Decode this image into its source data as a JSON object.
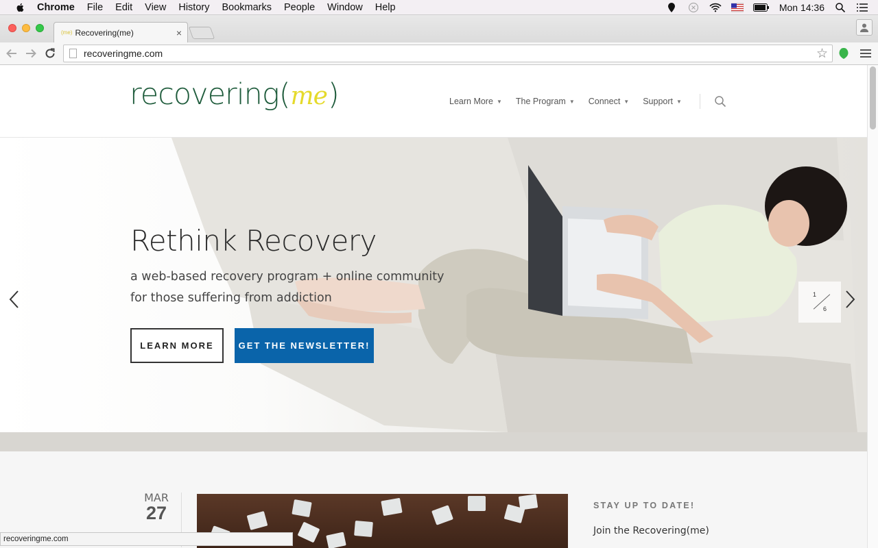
{
  "menubar": {
    "app": "Chrome",
    "items": [
      "File",
      "Edit",
      "View",
      "History",
      "Bookmarks",
      "People",
      "Window",
      "Help"
    ],
    "clock": "Mon 14:36"
  },
  "browser": {
    "tab_title": "Recovering(me)",
    "tab_favicon": "(me)",
    "url": "recoveringme.com",
    "status_url": "recoveringme.com"
  },
  "site": {
    "logo_prefix": "recovering(",
    "logo_me": "me",
    "logo_suffix": ")",
    "nav": [
      "Learn More",
      "The Program",
      "Connect",
      "Support"
    ],
    "hero": {
      "title": "Rethink Recovery",
      "subtitle_line1": "a web-based recovery program + online community",
      "subtitle_line2": "for those suffering from addiction",
      "btn_learn": "LEARN MORE",
      "btn_newsletter": "GET THE NEWSLETTER!",
      "slide_current": "1",
      "slide_total": "6"
    },
    "post": {
      "month": "MAR",
      "day": "27"
    },
    "sidebar": {
      "heading": "STAY UP TO DATE!",
      "text": "Join the Recovering(me)"
    }
  },
  "colors": {
    "logo_green": "#1f5c3c",
    "logo_yellow": "#e5da2c",
    "newsletter_blue": "#0a64aa"
  }
}
